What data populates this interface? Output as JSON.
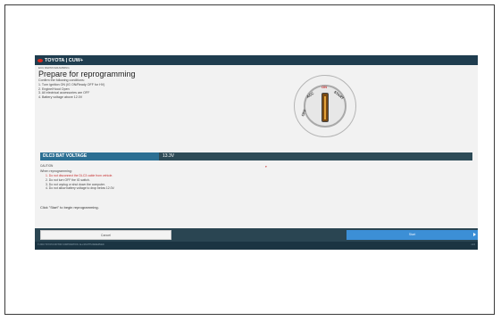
{
  "app": {
    "title": "TOYOTA | CUW+",
    "breadcrumb": "ECU REPROGRAMMING"
  },
  "prepare": {
    "heading": "Prepare for reprogramming",
    "intro": "Confirm the following conditions:",
    "steps": [
      "1. Turn ignition ON (IG ON/Ready OFF for HV)",
      "2. Engine/Hood Open",
      "3. All electrical accessories are OFF",
      "4. Battery voltage above 12.0V"
    ]
  },
  "ignition_knob": {
    "labels": [
      "OFF",
      "ACC",
      "ON",
      "START"
    ],
    "active_label": "ON"
  },
  "voltage": {
    "label": "DLC3 BAT VOLTAGE",
    "value": "13.3V"
  },
  "caution": {
    "section": "CAUTION",
    "marker": "▾",
    "title": "When reprogramming:",
    "items": [
      "1. Do not disconnect the DLC3 cable from vehicle.",
      "2. Do not turn OFF the IG switch.",
      "3. Do not unplug or shut down the computer.",
      "4. Do not allow battery voltage to drop below 12.0V."
    ],
    "red_items": [
      0
    ]
  },
  "instruction": "Click \"Start\" to begin reprogramming.",
  "buttons": {
    "cancel": "Cancel",
    "start": "Start"
  },
  "footer": {
    "copyright": "© 2016 TOYOTA MOTOR CORPORATION. ALL RIGHTS RESERVED.",
    "version": "v1.0"
  },
  "colors": {
    "titlebar": "#1f3d4f",
    "voltage_label_bg": "#2c6f93",
    "start_button": "#3c8fd6",
    "warning_red": "#c83232"
  }
}
